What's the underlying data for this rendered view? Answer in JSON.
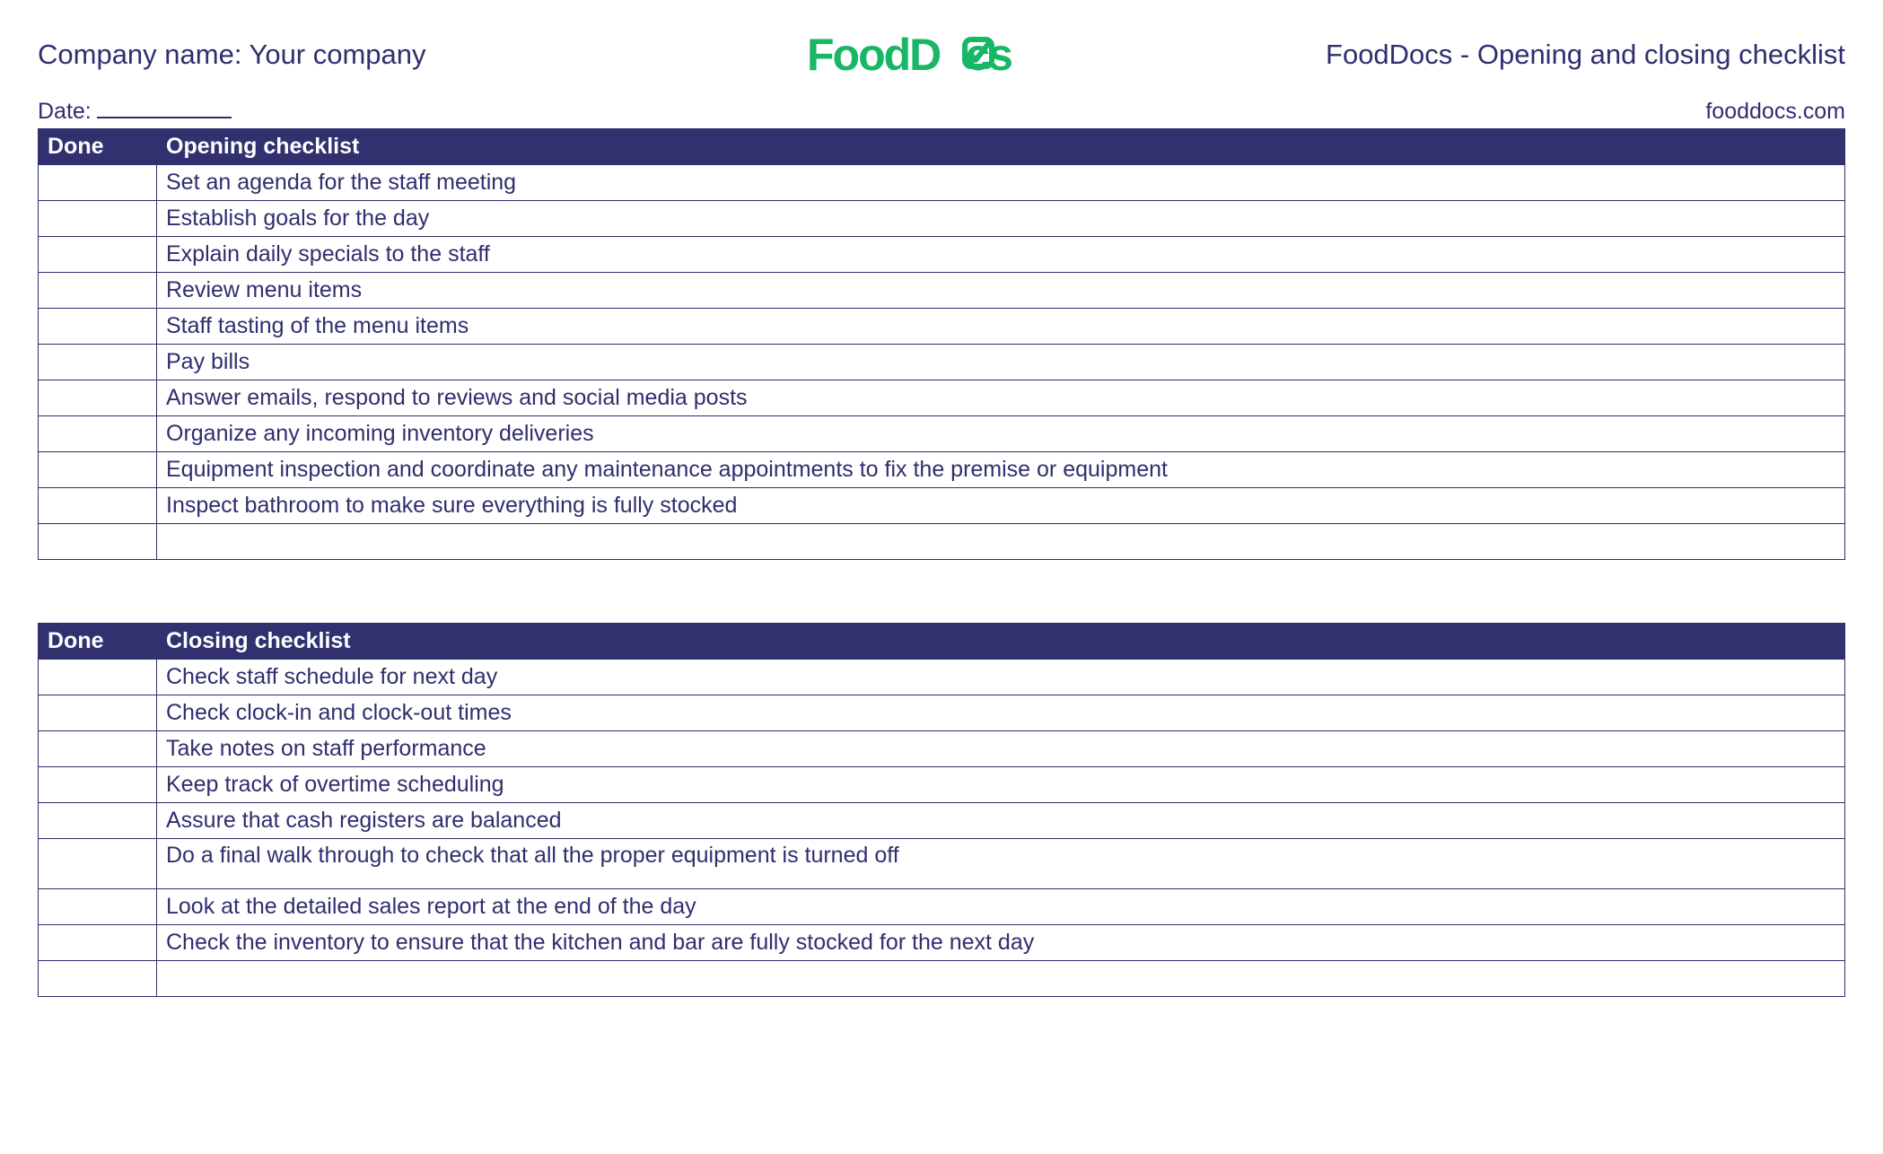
{
  "header": {
    "company_label": "Company name: Your company",
    "doc_title": "FoodDocs - Opening and closing checklist",
    "logo_text_food": "Food",
    "logo_text_d": "D",
    "logo_text_cs": "cs"
  },
  "subheader": {
    "date_label": "Date:",
    "website": "fooddocs.com"
  },
  "opening": {
    "done_header": "Done",
    "title": "Opening checklist",
    "items": [
      "Set an agenda for the staff meeting",
      "Establish goals for the day",
      "Explain daily specials to the staff",
      "Review menu items",
      "Staff tasting of the menu items",
      "Pay bills",
      "Answer emails, respond to reviews and social media posts",
      "Organize any incoming inventory deliveries",
      "Equipment inspection and coordinate any maintenance appointments to fix the premise or equipment",
      "Inspect bathroom to make sure everything is fully stocked",
      ""
    ]
  },
  "closing": {
    "done_header": "Done",
    "title": "Closing checklist",
    "items": [
      "Check staff schedule for next day",
      "Check clock-in and clock-out times",
      "Take notes on staff performance",
      "Keep track of overtime scheduling",
      "Assure that cash registers are balanced",
      "Do a final walk through to check that all the proper equipment is turned off",
      "Look at the detailed sales report at the end of the day",
      "Check the inventory to ensure that the kitchen and bar are fully stocked for the next day",
      ""
    ],
    "tall_row_index": 5
  }
}
